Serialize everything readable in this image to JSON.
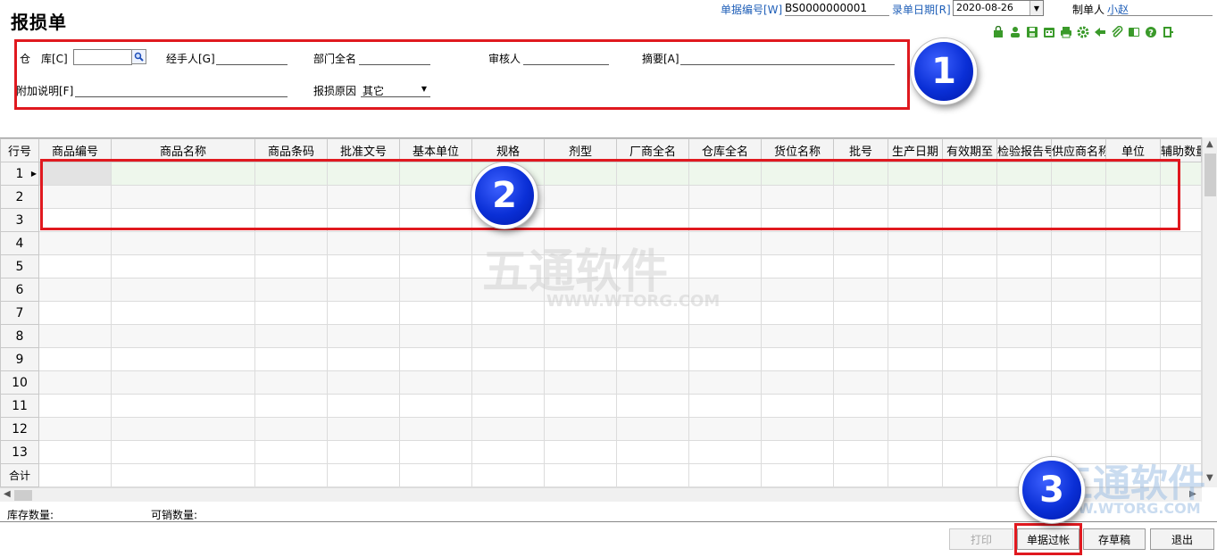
{
  "title": "报损单",
  "header": {
    "doc_no_label": "单据编号[W]",
    "doc_no_value": "BS0000000001",
    "date_label": "录单日期[R]",
    "date_value": "2020-08-26",
    "maker_label": "制单人",
    "maker_value": "小赵"
  },
  "toolbar_icons": [
    "bag-icon",
    "user-icon",
    "save-icon",
    "calendar-icon",
    "print-icon",
    "settings-icon",
    "share-icon",
    "attach-icon",
    "book-icon",
    "help-icon",
    "exit-icon"
  ],
  "form": {
    "warehouse_label": "仓　库[C]",
    "warehouse_value": "",
    "handler_label": "经手人[G]",
    "handler_value": "",
    "dept_label": "部门全名",
    "dept_value": "",
    "auditor_label": "审核人",
    "auditor_value": "",
    "summary_label": "摘要[A]",
    "summary_value": "",
    "note_label": "附加说明[F]",
    "note_value": "",
    "reason_label": "报损原因",
    "reason_value": "其它"
  },
  "grid": {
    "columns": [
      "行号",
      "商品编号",
      "商品名称",
      "商品条码",
      "批准文号",
      "基本单位",
      "规格",
      "剂型",
      "厂商全名",
      "仓库全名",
      "货位名称",
      "批号",
      "生产日期",
      "有效期至",
      "检验报告号",
      "供应商名称",
      "单位",
      "辅助数量"
    ],
    "row_numbers": [
      "1",
      "2",
      "3",
      "4",
      "5",
      "6",
      "7",
      "8",
      "9",
      "10",
      "11",
      "12",
      "13"
    ],
    "total_label": "合计"
  },
  "status": {
    "stock_label": "库存数量:",
    "sellable_label": "可销数量:"
  },
  "buttons": {
    "print": "打印",
    "post": "单据过帐",
    "draft": "存草稿",
    "exit": "退出"
  },
  "badges": [
    "1",
    "2",
    "3"
  ],
  "watermark": {
    "name": "五通软件",
    "url": "WWW.WTORG.COM"
  },
  "colors": {
    "highlight_red": "#e0191f",
    "badge_blue": "#0a2fd6",
    "link_blue": "#1f5fb8",
    "active_row": "#eef7ec"
  }
}
